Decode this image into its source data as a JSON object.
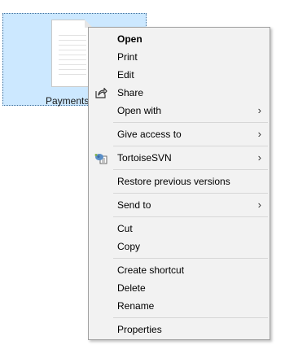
{
  "desktop": {
    "file": {
      "label": "Payments",
      "icon": "text-document-icon"
    }
  },
  "context_menu": {
    "items": {
      "open": "Open",
      "print": "Print",
      "edit": "Edit",
      "share": "Share",
      "open_with": "Open with",
      "give_access": "Give access to",
      "tortoisesvn": "TortoiseSVN",
      "restore": "Restore previous versions",
      "send_to": "Send to",
      "cut": "Cut",
      "copy": "Copy",
      "create_shortcut": "Create shortcut",
      "delete": "Delete",
      "rename": "Rename",
      "properties": "Properties"
    },
    "submenu_arrow": "›",
    "icons": {
      "share": "share-icon",
      "tortoisesvn": "tortoisesvn-icon"
    }
  },
  "colors": {
    "selection": "#cce8ff",
    "menu_background": "#f2f2f2",
    "menu_border": "#a0a0a0",
    "separator": "#d7d7d7"
  }
}
